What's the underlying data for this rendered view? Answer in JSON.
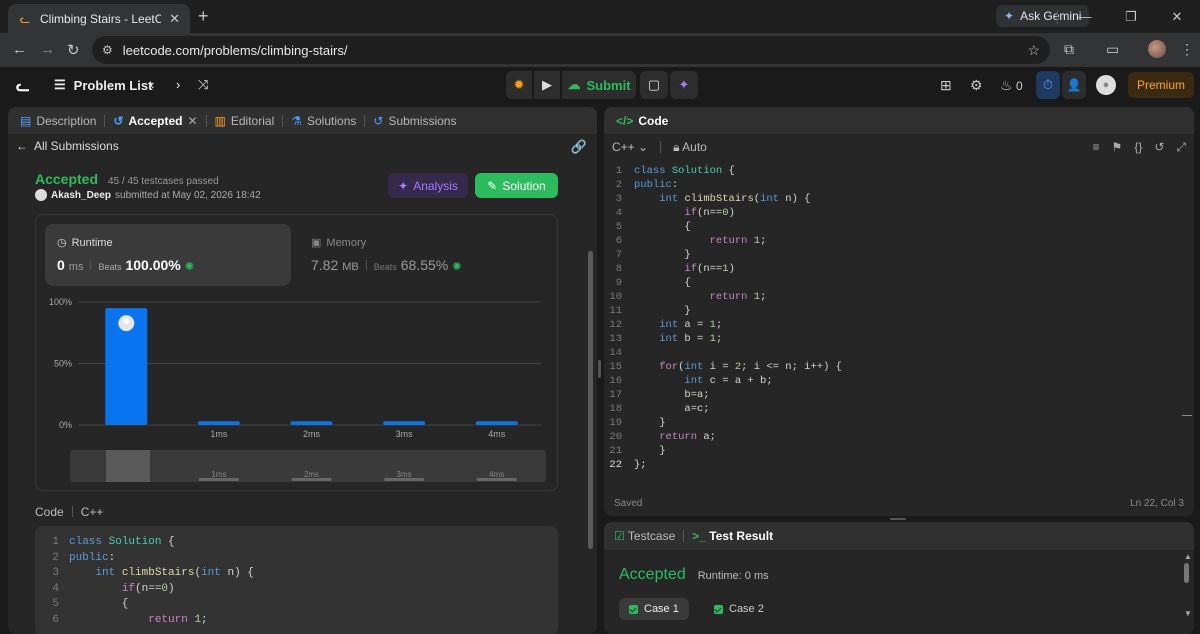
{
  "browser": {
    "tab_title": "Climbing Stairs - LeetCode",
    "gemini_label": "Ask Gemini",
    "url": "leetcode.com/problems/climbing-stairs/"
  },
  "header": {
    "problem_list": "Problem List",
    "submit_label": "Submit",
    "streak_count": "0",
    "premium_label": "Premium"
  },
  "left_tabs": [
    {
      "label": "Description",
      "icon": "description-icon"
    },
    {
      "label": "Accepted",
      "icon": "history-icon"
    },
    {
      "label": "Editorial",
      "icon": "editorial-icon"
    },
    {
      "label": "Solutions",
      "icon": "flask-icon"
    },
    {
      "label": "Submissions",
      "icon": "history-icon"
    }
  ],
  "submission": {
    "back_label": "All Submissions",
    "status": "Accepted",
    "testcases": "45 / 45 testcases passed",
    "user": "Akash_Deep",
    "submitted_text": "submitted at May 02, 2026 18:42",
    "analysis_label": "Analysis",
    "solution_label": "Solution"
  },
  "stats": {
    "runtime_label": "Runtime",
    "runtime_value": "0",
    "runtime_unit": "ms",
    "runtime_beats_label": "Beats",
    "runtime_beats": "100.00%",
    "memory_label": "Memory",
    "memory_value": "7.82",
    "memory_unit": "MB",
    "memory_beats_label": "Beats",
    "memory_beats": "68.55%"
  },
  "chart_data": {
    "type": "bar",
    "categories": [
      "0ms",
      "1ms",
      "2ms",
      "3ms",
      "4ms"
    ],
    "x_tick_labels": [
      "",
      "1ms",
      "2ms",
      "3ms",
      "4ms"
    ],
    "values": [
      95,
      3,
      3,
      3,
      3
    ],
    "y_ticks": [
      "100%",
      "50%",
      "0%"
    ],
    "ylim": [
      0,
      100
    ],
    "highlight_index": 0,
    "bar_color": "#0a74f0",
    "overview_labels": [
      "1ms",
      "2ms",
      "3ms",
      "4ms"
    ]
  },
  "code_section": {
    "label": "Code",
    "lang": "C++",
    "lines": [
      "class Solution {",
      "public:",
      "    int climbStairs(int n) {",
      "        if(n==0)",
      "        {",
      "            return 1;"
    ]
  },
  "editor": {
    "title": "Code",
    "lang": "C++",
    "mode": "Auto",
    "status": "Saved",
    "cursor": "Ln 22, Col 3",
    "lines": [
      "class Solution {",
      "public:",
      "    int climbStairs(int n) {",
      "        if(n==0)",
      "        {",
      "            return 1;",
      "        }",
      "        if(n==1)",
      "        {",
      "            return 1;",
      "        }",
      "    int a = 1;",
      "    int b = 1;",
      "",
      "    for(int i = 2; i <= n; i++) {",
      "        int c = a + b;",
      "        b=a;",
      "        a=c;",
      "    }",
      "    return a;",
      "    }",
      "};"
    ]
  },
  "test_panel": {
    "tab1": "Testcase",
    "tab2": "Test Result",
    "result": "Accepted",
    "runtime": "Runtime: 0 ms",
    "case1": "Case 1",
    "case2": "Case 2"
  }
}
